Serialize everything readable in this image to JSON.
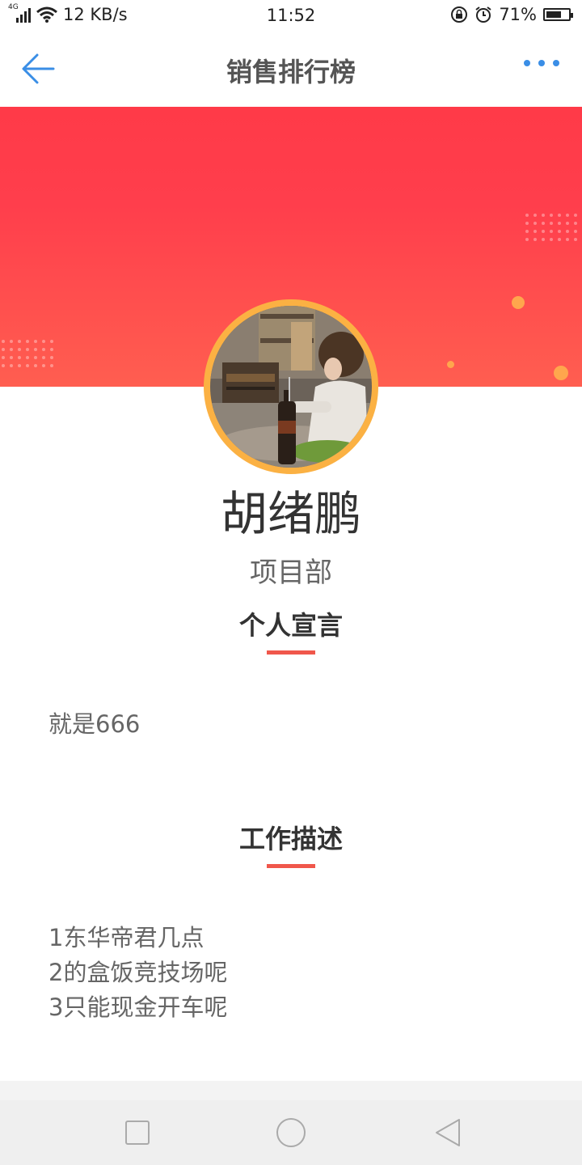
{
  "status_bar": {
    "network_type": "4G",
    "speed": "12 KB/s",
    "time": "11:52",
    "battery": "71%",
    "battery_level": 0.71
  },
  "header": {
    "title": "销售排行榜",
    "back_icon": "arrow-left-icon",
    "more_icon": "more-dots-icon",
    "accent_color": "#3a8ee6"
  },
  "banner": {
    "gradient_top": "#ff3a48",
    "gradient_bottom": "#ff5e50"
  },
  "profile": {
    "name": "胡绪鹏",
    "department": "项目部",
    "avatar_border_color": "#fbb143"
  },
  "sections": {
    "declaration": {
      "title": "个人宣言",
      "content": "就是666"
    },
    "work": {
      "title": "工作描述",
      "lines": [
        "1东华帝君几点",
        "2的盒饭竞技场呢",
        "3只能现金开车呢"
      ]
    }
  },
  "system_nav": {
    "recents_icon": "square-icon",
    "home_icon": "circle-icon",
    "back_icon": "triangle-back-icon"
  }
}
